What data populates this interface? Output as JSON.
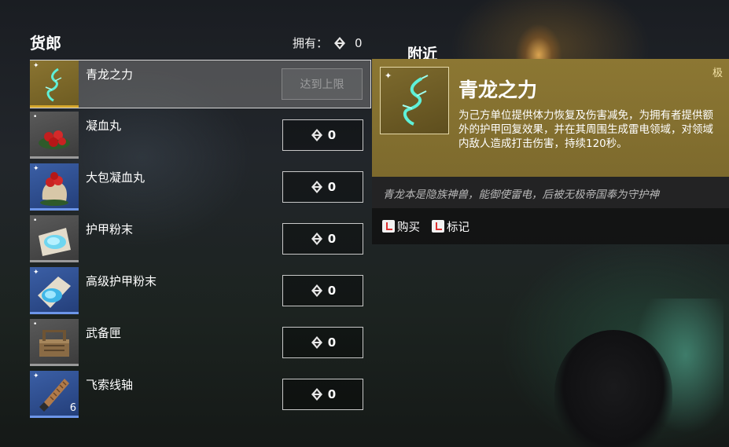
{
  "shop": {
    "title": "货郎",
    "owned_label": "拥有：",
    "owned_count": "0"
  },
  "nearby": {
    "label": "附近"
  },
  "items": [
    {
      "name": "青龙之力",
      "price": "达到上限",
      "selected": true,
      "rarity": "gold",
      "qty": ""
    },
    {
      "name": "凝血丸",
      "price": "0",
      "rarity": "grey",
      "qty": ""
    },
    {
      "name": "大包凝血丸",
      "price": "0",
      "rarity": "blue",
      "qty": ""
    },
    {
      "name": "护甲粉末",
      "price": "0",
      "rarity": "grey",
      "qty": ""
    },
    {
      "name": "高级护甲粉末",
      "price": "0",
      "rarity": "blue",
      "qty": ""
    },
    {
      "name": "武备匣",
      "price": "0",
      "rarity": "grey",
      "qty": ""
    },
    {
      "name": "飞索线轴",
      "price": "0",
      "rarity": "blue",
      "qty": "6"
    }
  ],
  "detail": {
    "name": "青龙之力",
    "grade": "极",
    "description": "为己方单位提供体力恢复及伤害减免，为拥有者提供额外的护甲回复效果，并在其周围生成雷电领域，对领域内敌人造成打击伤害，持续120秒。",
    "lore": "青龙本是隐族神兽，能御使雷电，后被无极帝国奉为守护神",
    "actions": {
      "buy": "购买",
      "mark": "标记"
    }
  },
  "colors": {
    "gold_panel": "#8c7733",
    "gold_border": "#d6a72b",
    "blue_border": "#6c95e8"
  },
  "icons": [
    "coin-icon",
    "dragon-icon",
    "pill-icon",
    "pill-bag-icon",
    "powder-icon",
    "crate-icon",
    "rope-spool-icon",
    "key-icon"
  ]
}
